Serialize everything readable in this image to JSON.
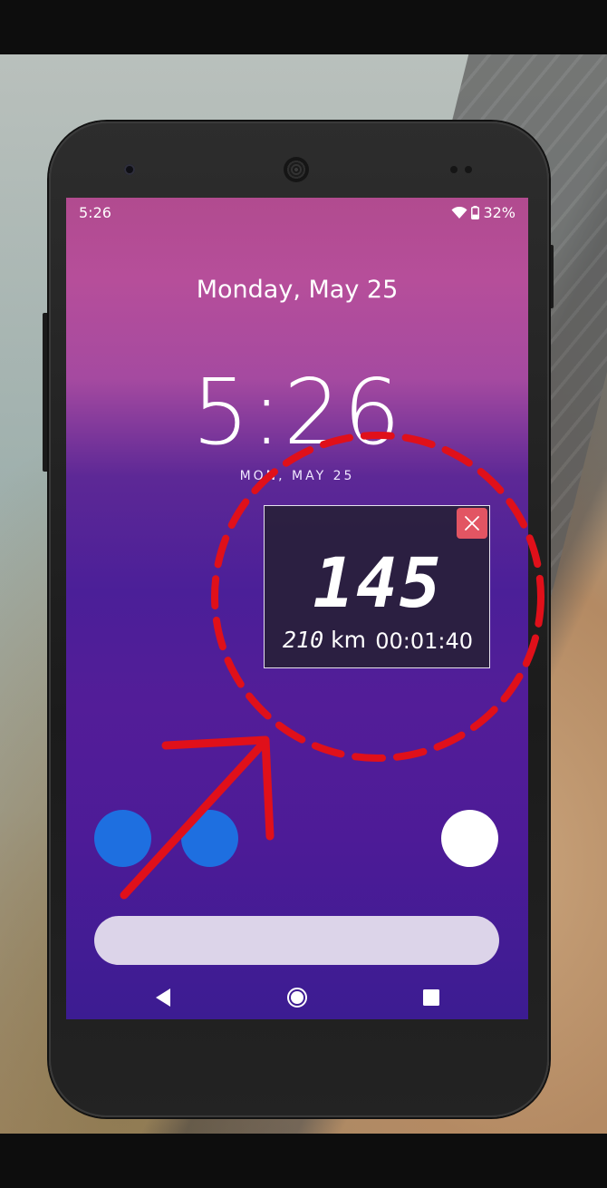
{
  "status_bar": {
    "time": "5:26",
    "battery": "32%",
    "icons": [
      "wifi-icon",
      "battery-icon"
    ]
  },
  "lock_screen": {
    "date_top": "Monday, May 25",
    "clock": "5:26",
    "date_sub": "MON, MAY 25"
  },
  "speed_widget": {
    "speed": "145",
    "distance_value": "210",
    "distance_unit": "km",
    "elapsed_time": "00:01:40",
    "close_icon": "close-icon",
    "close_color": "#e25563"
  },
  "shortcuts": {
    "left_color": "#1e6fe0",
    "right_color": "#ffffff"
  },
  "nav_bar": {
    "icons": [
      "back-icon",
      "home-icon",
      "recents-icon"
    ]
  },
  "annotation": {
    "color": "#e0101a",
    "shapes": [
      "dashed-circle",
      "arrow"
    ]
  }
}
